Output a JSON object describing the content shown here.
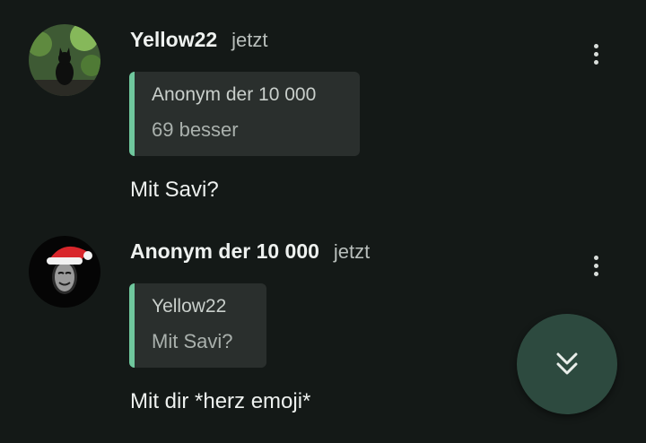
{
  "messages": [
    {
      "author": "Yellow22",
      "time": "jetzt",
      "avatar_icon": "black-cat-avatar-icon",
      "quote": {
        "author": "Anonym der 10 000",
        "text": "69 besser"
      },
      "text": "Mit Savi?"
    },
    {
      "author": "Anonym der 10 000",
      "time": "jetzt",
      "avatar_icon": "anonymous-mask-santa-hat-avatar-icon",
      "quote": {
        "author": "Yellow22",
        "text": "Mit Savi?"
      },
      "text": "Mit dir *herz emoji*"
    }
  ],
  "colors": {
    "background": "#141917",
    "quote_background": "#2a2f2d",
    "quote_accent": "#6fc79d",
    "fab_background": "#2d4a3f"
  },
  "fab": {
    "icon": "double-chevron-down-icon"
  }
}
